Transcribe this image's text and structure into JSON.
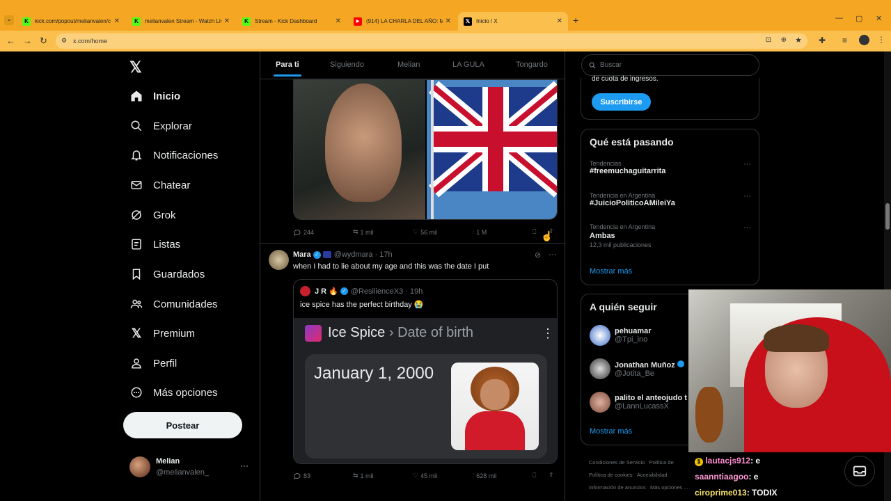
{
  "browser": {
    "tabs": [
      {
        "label": "kick.com/popout/melianvalen/c",
        "icon": "kick-icon",
        "color": "#53fc18"
      },
      {
        "label": "melianvalen Stream - Watch Liv",
        "icon": "kick-icon",
        "color": "#53fc18"
      },
      {
        "label": "Stream - Kick Dashboard",
        "icon": "kick-icon",
        "color": "#53fc18"
      },
      {
        "label": "(914) LA CHARLA DEL AÑO: Me",
        "icon": "youtube-icon",
        "color": "#ff0000"
      },
      {
        "label": "Inicio / X",
        "icon": "x-logo-icon",
        "color": "#000000"
      }
    ],
    "url": "x.com/home"
  },
  "sidebar": {
    "items": [
      {
        "label": "Inicio",
        "icon": "home-icon"
      },
      {
        "label": "Explorar",
        "icon": "search-icon"
      },
      {
        "label": "Notificaciones",
        "icon": "bell-icon"
      },
      {
        "label": "Chatear",
        "icon": "mail-icon"
      },
      {
        "label": "Grok",
        "icon": "grok-icon"
      },
      {
        "label": "Listas",
        "icon": "list-icon"
      },
      {
        "label": "Guardados",
        "icon": "bookmark-icon"
      },
      {
        "label": "Comunidades",
        "icon": "people-icon"
      },
      {
        "label": "Premium",
        "icon": "x-logo-icon"
      },
      {
        "label": "Perfil",
        "icon": "person-icon"
      },
      {
        "label": "Más opciones",
        "icon": "more-circle-icon"
      }
    ],
    "post_button": "Postear",
    "account": {
      "name": "Melian",
      "handle": "@melianvalen_"
    }
  },
  "feed": {
    "tabs": [
      "Para ti",
      "Siguiendo",
      "Melian",
      "LA GULA",
      "Tongardo"
    ],
    "post1_stats": {
      "replies": "244",
      "reposts": "1 mil",
      "likes": "56 mil",
      "views": "1 M"
    },
    "post2": {
      "name": "Mara",
      "handle": "@wydmara",
      "time": "· 17h",
      "text": "when I had to lie about my age and this was the date I put",
      "quote": {
        "name": "J R",
        "handle": "@ResilienceX3",
        "time": "· 19h",
        "text": "ice spice has the perfect birthday 😭",
        "card_name": "Ice Spice",
        "card_sep": "›",
        "card_field": "Date of birth",
        "card_value": "January 1, 2000"
      },
      "stats": {
        "replies": "83",
        "reposts": "1 mil",
        "likes": "45 mil",
        "views": "628 mil"
      }
    }
  },
  "right": {
    "search_placeholder": "Buscar",
    "premium_text": "de cuota de ingresos.",
    "subscribe": "Suscribirse",
    "trending_title": "Qué está pasando",
    "trends": [
      {
        "meta": "Tendencias",
        "title": "#freemuchaguitarrita",
        "count": ""
      },
      {
        "meta": "Tendencia en Argentina",
        "title": "#JuicioPoliticoAMileiYa",
        "count": ""
      },
      {
        "meta": "Tendencia en Argentina",
        "title": "Ambas",
        "count": "12,3 mil publicaciones"
      }
    ],
    "show_more": "Mostrar más",
    "follow_title": "A quién seguir",
    "follow": [
      {
        "name": "pehuamar",
        "handle": "@Tpi_ino"
      },
      {
        "name": "Jonathan Muñoz",
        "handle": "@Jotita_Be"
      },
      {
        "name": "palito el anteojudo t",
        "handle": "@LannLucassX"
      }
    ],
    "footer": [
      "Condiciones de Servicio",
      "Política de",
      "Política de cookies",
      "Accesibilidad",
      "Información de anuncios",
      "Más opciones ..."
    ]
  },
  "stream_chat": [
    {
      "user": "lautacjs912",
      "msg": ": e",
      "color": "#ff8fd0"
    },
    {
      "user": "saanntiaagoo",
      "msg": ": e",
      "color": "#ff9ad6"
    },
    {
      "user": "ciroprime013",
      "msg": ": TODIX",
      "color": "#f7e36a"
    }
  ]
}
